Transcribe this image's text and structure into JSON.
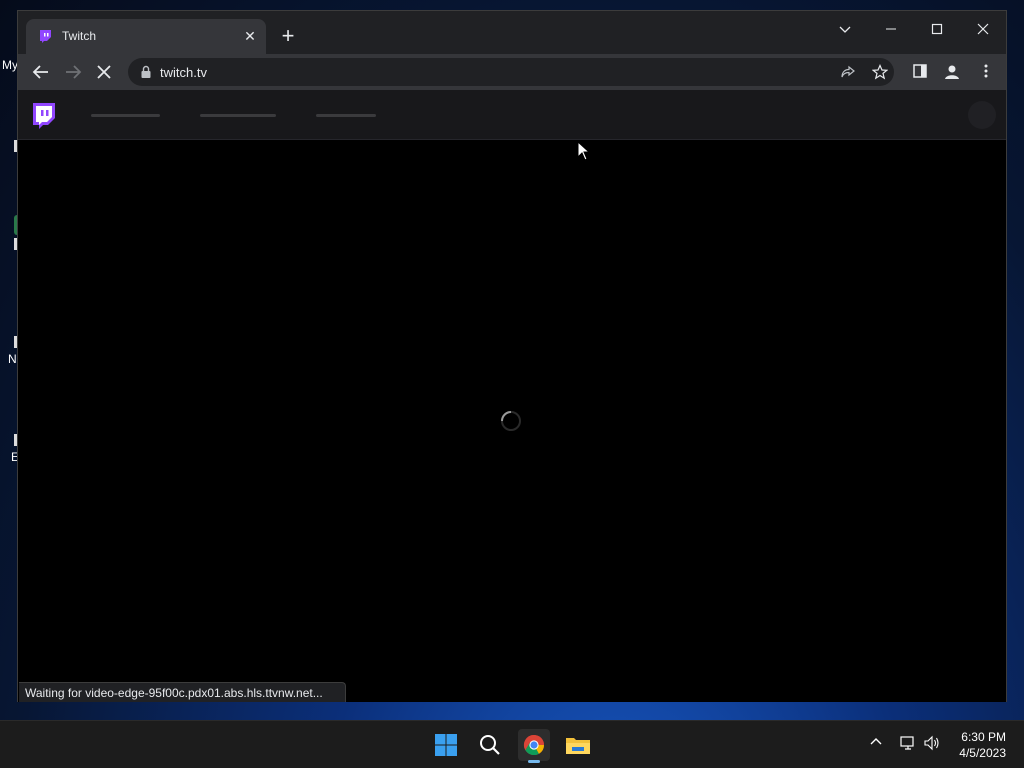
{
  "desktop": {
    "icon_labels": [
      "My",
      "N",
      "E"
    ]
  },
  "browser": {
    "tab_title": "Twitch",
    "url": "twitch.tv",
    "status_text": "Waiting for video-edge-95f00c.pdx01.abs.hls.ttvnw.net...",
    "accent_color": "#9146ff"
  },
  "taskbar": {
    "apps": [
      "start-icon",
      "search-icon",
      "chrome-icon",
      "file-explorer-icon"
    ],
    "time": "6:30 PM",
    "date": "4/5/2023"
  }
}
